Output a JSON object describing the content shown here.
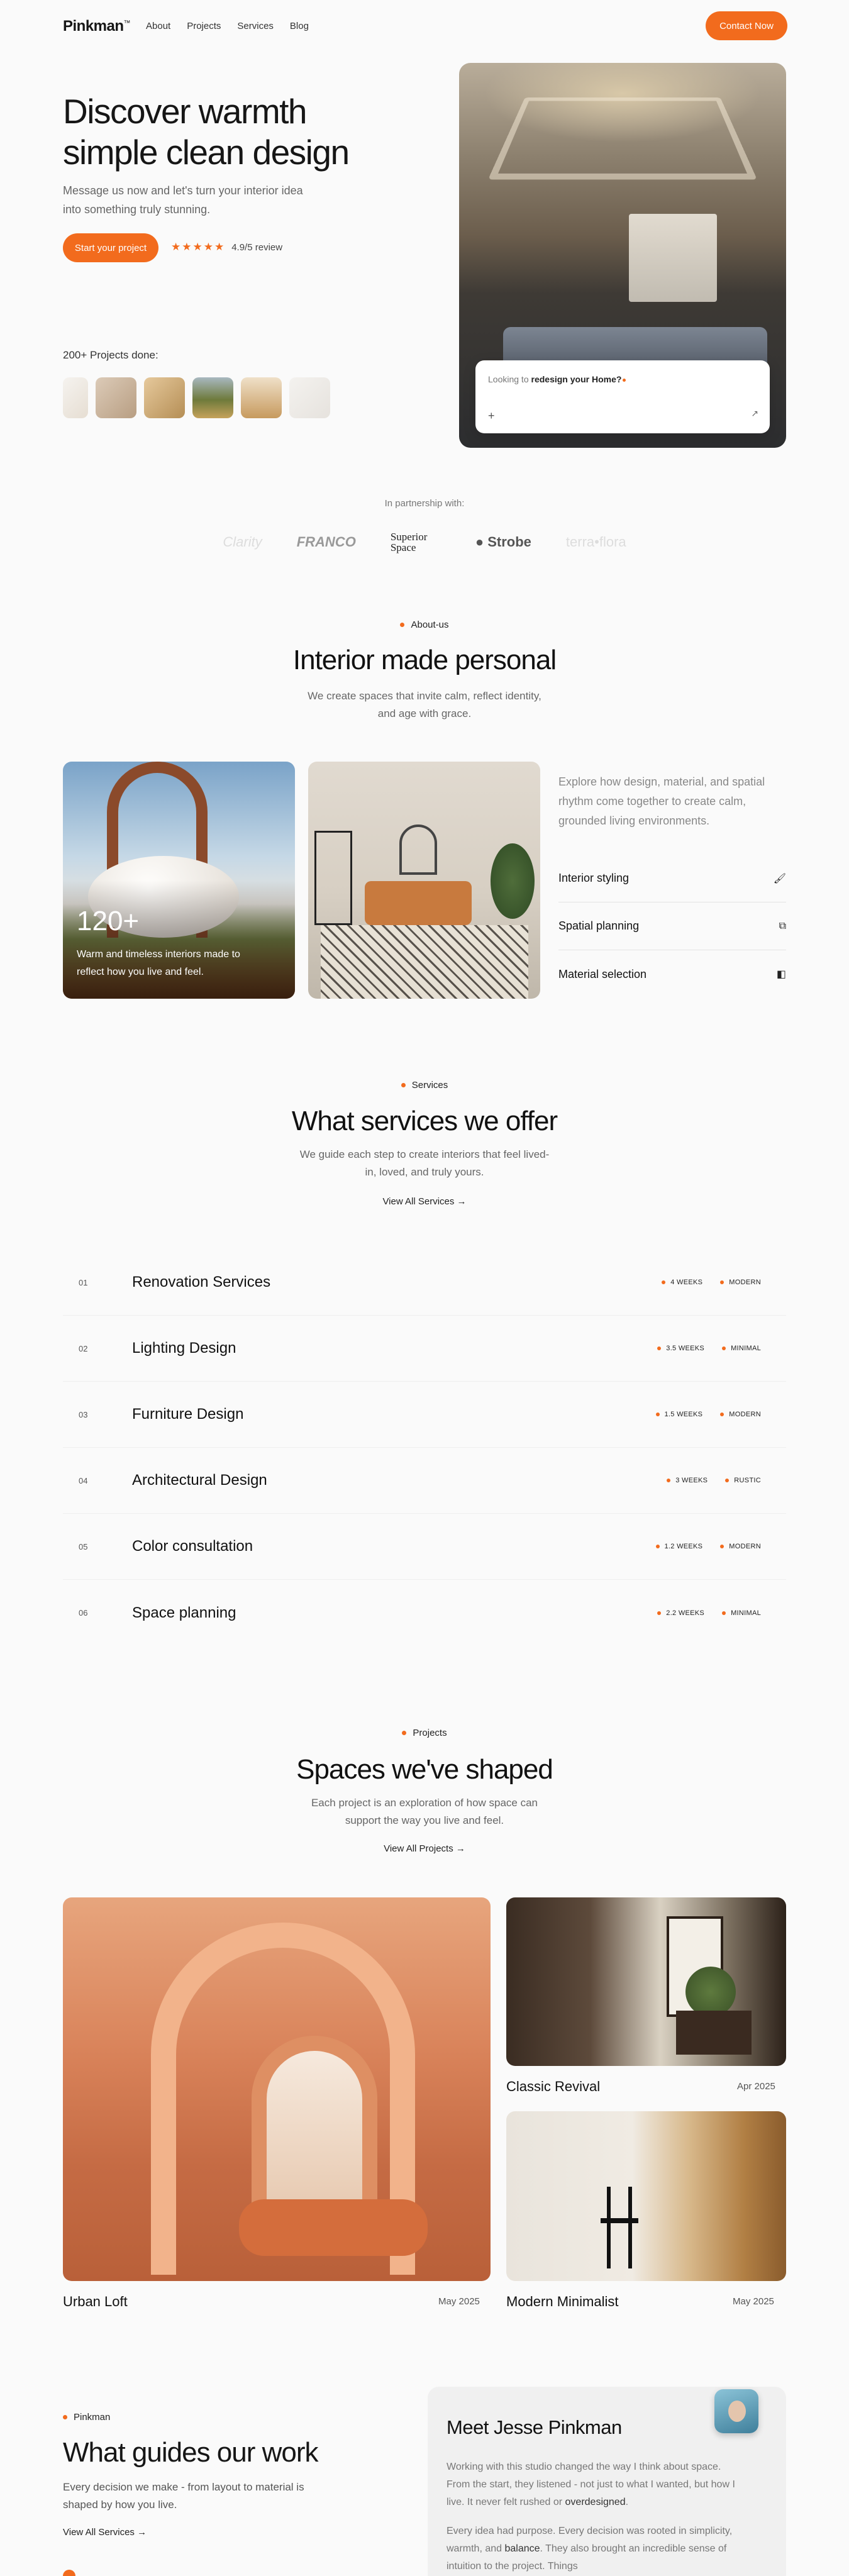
{
  "nav": {
    "logo": "Pinkman",
    "logo_mark": "™",
    "links": [
      "About",
      "Projects",
      "Services",
      "Blog"
    ],
    "cta": "Contact Now"
  },
  "hero": {
    "title_line1": "Discover warmth",
    "title_line2": "simple clean design",
    "subtitle": "Message us now and let's turn your interior idea into something truly stunning.",
    "button": "Start your project",
    "stars": "★★★★★",
    "rating": "4.9/5 review",
    "projects_done": "200+ Projects done:",
    "chat_prefix": "Looking to",
    "chat_bold": "redesign your Home?",
    "chat_plus": "+",
    "chat_send": "↗"
  },
  "partners": {
    "label": "In partnership with:",
    "logos": [
      "Clarity",
      "FRANCO",
      "Superior Space",
      "Strobe",
      "terra•flora"
    ]
  },
  "about": {
    "pill": "About-us",
    "title": "Interior made personal",
    "subtitle": "We create spaces that invite calm, reflect identity, and age with grace.",
    "stat": "120+",
    "stat_text": "Warm and timeless interiors made to reflect how you live and feel.",
    "description": "Explore how design, material, and spatial rhythm come together to create calm, grounded living environments.",
    "features": [
      {
        "label": "Interior styling",
        "icon": "🖌"
      },
      {
        "label": "Spatial planning",
        "icon": "⧉"
      },
      {
        "label": "Material selection",
        "icon": "◧"
      }
    ]
  },
  "services": {
    "pill": "Services",
    "title": "What services we offer",
    "subtitle": "We guide each step to create interiors that feel lived-in, loved, and truly yours.",
    "link": "View All Services →",
    "items": [
      {
        "num": "01",
        "name": "Renovation Services",
        "duration": "4 WEEKS",
        "style": "MODERN"
      },
      {
        "num": "02",
        "name": "Lighting Design",
        "duration": "3.5 WEEKS",
        "style": "MINIMAL"
      },
      {
        "num": "03",
        "name": "Furniture Design",
        "duration": "1.5 WEEKS",
        "style": "MODERN"
      },
      {
        "num": "04",
        "name": "Architectural Design",
        "duration": "3 WEEKS",
        "style": "RUSTIC"
      },
      {
        "num": "05",
        "name": "Color consultation",
        "duration": "1.2 WEEKS",
        "style": "MODERN"
      },
      {
        "num": "06",
        "name": "Space planning",
        "duration": "2.2 WEEKS",
        "style": "MINIMAL"
      }
    ]
  },
  "projects": {
    "pill": "Projects",
    "title": "Spaces we've shaped",
    "subtitle": "Each project is an exploration of how space can support the way you live and feel.",
    "link": "View All Projects →",
    "items": [
      {
        "name": "Urban Loft",
        "date": "May 2025"
      },
      {
        "name": "Classic Revival",
        "date": "Apr 2025"
      },
      {
        "name": "Modern Minimalist",
        "date": "May 2025"
      }
    ]
  },
  "guides": {
    "pill": "Pinkman",
    "title": "What guides our work",
    "subtitle": "Every decision we make - from layout to material is shaped by how you live.",
    "link": "View All Services →"
  },
  "testimonial": {
    "title": "Meet Jesse Pinkman",
    "p1_a": "Working with this studio changed the way I think about space. From the start, they listened - not just to what I wanted, but how I live. It never felt rushed or ",
    "p1_b": "overdesigned",
    "p1_c": ".",
    "p2_a": "Every idea had purpose. Every decision was rooted in simplicity, warmth, and ",
    "p2_b": "balance",
    "p2_c": ". They also brought an incredible sense of intuition to the project. Things"
  },
  "colors": {
    "accent": "#f26b1d",
    "background": "#fafafa",
    "text": "#161616"
  }
}
